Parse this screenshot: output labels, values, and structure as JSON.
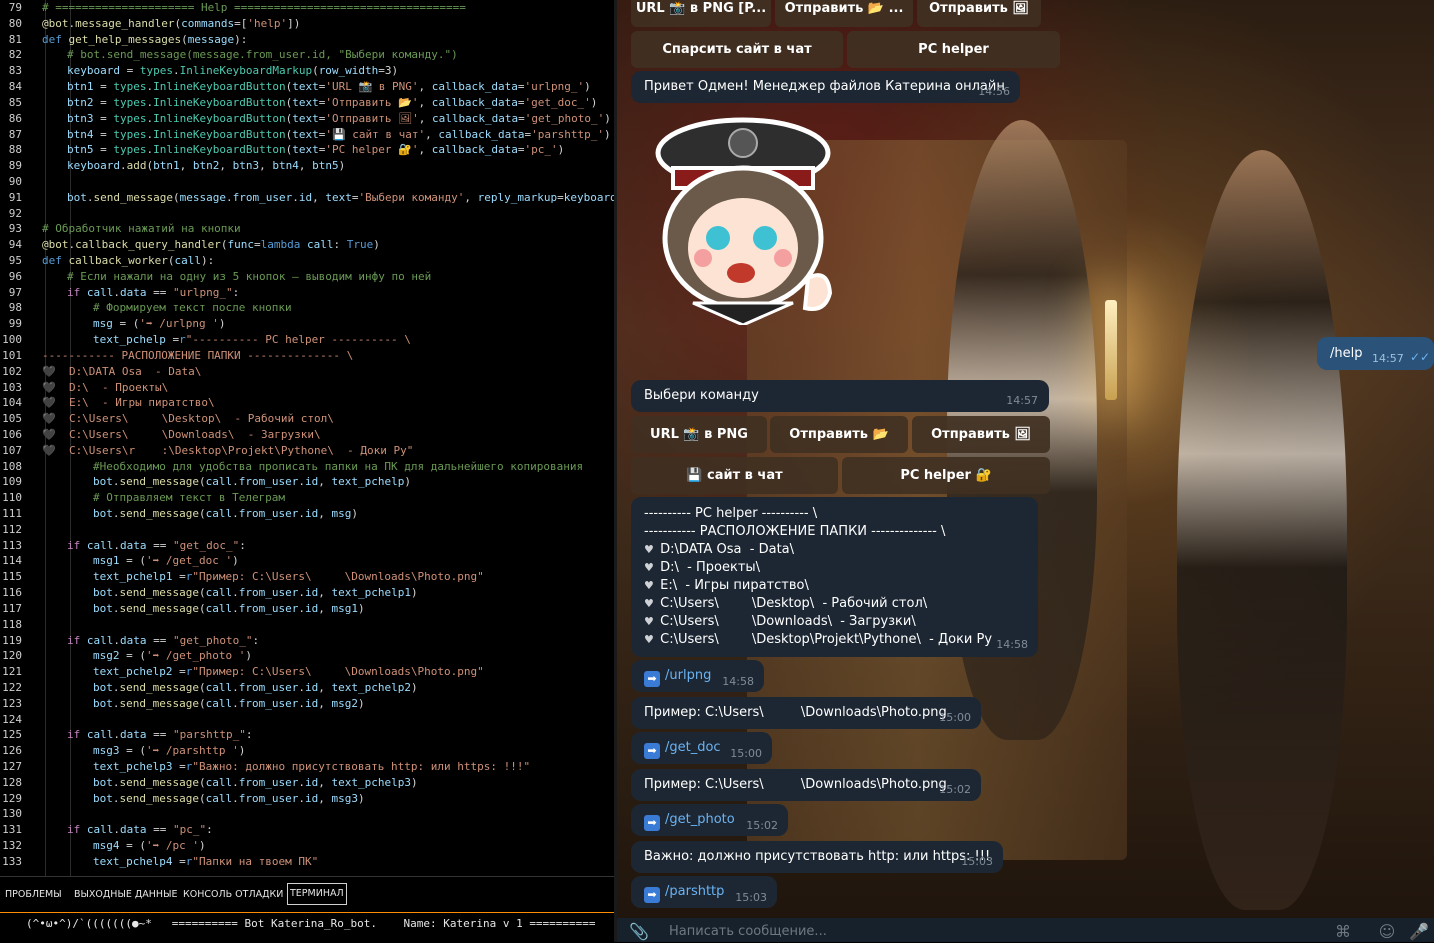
{
  "editor": {
    "lines": [
      {
        "n": "79",
        "indent": 0,
        "html": "<span class='c-comment'># ===================== Help ===================================</span>"
      },
      {
        "n": "80",
        "indent": 0,
        "html": "<span class='c-dec'>@bot</span>.<span class='c-fn'>message_handler</span>(<span class='c-var'>commands</span>=[<span class='c-str'>'help'</span>])"
      },
      {
        "n": "81",
        "indent": 0,
        "html": "<span class='c-kw'>def</span> <span class='c-fn'>get_help_messages</span>(<span class='c-var'>message</span>):"
      },
      {
        "n": "82",
        "indent": 1,
        "html": "<span class='c-comment'># bot.send_message(message.from_user.id, \"Выбери команду.\")</span>"
      },
      {
        "n": "83",
        "indent": 1,
        "html": "<span class='c-var'>keyboard</span> = <span class='c-cls'>types</span>.<span class='c-cls'>InlineKeyboardMarkup</span>(<span class='c-var'>row_width</span>=3)"
      },
      {
        "n": "84",
        "indent": 1,
        "html": "<span class='c-var'>btn1</span> = <span class='c-cls'>types</span>.<span class='c-cls'>InlineKeyboardButton</span>(<span class='c-var'>text</span>=<span class='c-str'>'URL 📸 в PNG'</span>, <span class='c-var'>callback_data</span>=<span class='c-str'>'urlpng_'</span>)"
      },
      {
        "n": "85",
        "indent": 1,
        "html": "<span class='c-var'>btn2</span> = <span class='c-cls'>types</span>.<span class='c-cls'>InlineKeyboardButton</span>(<span class='c-var'>text</span>=<span class='c-str'>'Отправить 📂'</span>, <span class='c-var'>callback_data</span>=<span class='c-str'>'get_doc_'</span>)"
      },
      {
        "n": "86",
        "indent": 1,
        "html": "<span class='c-var'>btn3</span> = <span class='c-cls'>types</span>.<span class='c-cls'>InlineKeyboardButton</span>(<span class='c-var'>text</span>=<span class='c-str'>'Отправить 🖼'</span>, <span class='c-var'>callback_data</span>=<span class='c-str'>'get_photo_'</span>)"
      },
      {
        "n": "87",
        "indent": 1,
        "html": "<span class='c-var'>btn4</span> = <span class='c-cls'>types</span>.<span class='c-cls'>InlineKeyboardButton</span>(<span class='c-var'>text</span>=<span class='c-str'>'💾 сайт в чат'</span>, <span class='c-var'>callback_data</span>=<span class='c-str'>'parshttp_'</span>)"
      },
      {
        "n": "88",
        "indent": 1,
        "html": "<span class='c-var'>btn5</span> = <span class='c-cls'>types</span>.<span class='c-cls'>InlineKeyboardButton</span>(<span class='c-var'>text</span>=<span class='c-str'>'PC helper 🔐'</span>, <span class='c-var'>callback_data</span>=<span class='c-str'>'pc_'</span>)"
      },
      {
        "n": "89",
        "indent": 1,
        "html": "<span class='c-var'>keyboard</span>.<span class='c-fn'>add</span>(<span class='c-var'>btn1</span>, <span class='c-var'>btn2</span>, <span class='c-var'>btn3</span>, <span class='c-var'>btn4</span>, <span class='c-var'>btn5</span>)"
      },
      {
        "n": "90",
        "indent": 1,
        "html": ""
      },
      {
        "n": "91",
        "indent": 1,
        "html": "<span class='c-var'>bot</span>.<span class='c-fn'>send_message</span>(<span class='c-var'>message</span>.<span class='c-var'>from_user</span>.<span class='c-var'>id</span>, <span class='c-var'>text</span>=<span class='c-str'>'Выбери команду'</span>, <span class='c-var'>reply_markup</span>=<span class='c-var'>keyboard</span>)"
      },
      {
        "n": "92",
        "indent": 0,
        "html": ""
      },
      {
        "n": "93",
        "indent": 0,
        "html": "<span class='c-comment'># Обработчик нажатий на кнопки</span>"
      },
      {
        "n": "94",
        "indent": 0,
        "html": "<span class='c-dec'>@bot</span>.<span class='c-fn'>callback_query_handler</span>(<span class='c-var'>func</span>=<span class='c-kw'>lambda</span> <span class='c-var'>call</span>: <span class='c-kw'>True</span>)"
      },
      {
        "n": "95",
        "indent": 0,
        "html": "<span class='c-kw'>def</span> <span class='c-fn'>callback_worker</span>(<span class='c-var'>call</span>):"
      },
      {
        "n": "96",
        "indent": 1,
        "html": "<span class='c-comment'># Если нажали на одну из 5 кнопок — выводим инфу по ней</span>"
      },
      {
        "n": "97",
        "indent": 1,
        "html": "<span class='c-ctl'>if</span> <span class='c-var'>call</span>.<span class='c-var'>data</span> == <span class='c-str'>\"urlpng_\"</span>:"
      },
      {
        "n": "98",
        "indent": 2,
        "html": "<span class='c-comment'># Формируем текст после кнопки</span>"
      },
      {
        "n": "99",
        "indent": 2,
        "html": "<span class='c-var'>msg</span> = (<span class='c-str'>'➡ /urlpng '</span>)"
      },
      {
        "n": "100",
        "indent": 2,
        "html": "<span class='c-var'>text_pchelp</span> =<span class='c-kw'>r</span><span class='c-str'>\"---------- PC helper ---------- \\</span>"
      },
      {
        "n": "101",
        "indent": 0,
        "html": "<span class='c-str'>----------- РАСПОЛОЖЕНИЕ ПАПКИ -------------- \\</span>"
      },
      {
        "n": "102",
        "indent": 0,
        "html": "<span class='c-str'>🖤  D:\\DATA Osa  - Data\\</span>"
      },
      {
        "n": "103",
        "indent": 0,
        "html": "<span class='c-str'>🖤  D:\\  - Проекты\\</span>"
      },
      {
        "n": "104",
        "indent": 0,
        "html": "<span class='c-str'>🖤  E:\\  - Игры пиратство\\</span>"
      },
      {
        "n": "105",
        "indent": 0,
        "html": "<span class='c-str'>🖤  C:\\Users\\     \\Desktop\\  - Рабочий стол\\</span>"
      },
      {
        "n": "106",
        "indent": 0,
        "html": "<span class='c-str'>🖤  C:\\Users\\     \\Downloads\\  - Загрузки\\</span>"
      },
      {
        "n": "107",
        "indent": 0,
        "html": "<span class='c-str'>🖤  C:\\Users\\r    :\\Desktop\\Projekt\\Pythone\\  - Доки Ру\"</span>"
      },
      {
        "n": "108",
        "indent": 2,
        "html": "<span class='c-comment'>#Необходимо для удобства прописать папки на ПК для дальнейшего копирования</span>"
      },
      {
        "n": "109",
        "indent": 2,
        "html": "<span class='c-var'>bot</span>.<span class='c-fn'>send_message</span>(<span class='c-var'>call</span>.<span class='c-var'>from_user</span>.<span class='c-var'>id</span>, <span class='c-var'>text_pchelp</span>)"
      },
      {
        "n": "110",
        "indent": 2,
        "html": "<span class='c-comment'># Отправляем текст в Телеграм</span>"
      },
      {
        "n": "111",
        "indent": 2,
        "html": "<span class='c-var'>bot</span>.<span class='c-fn'>send_message</span>(<span class='c-var'>call</span>.<span class='c-var'>from_user</span>.<span class='c-var'>id</span>, <span class='c-var'>msg</span>)"
      },
      {
        "n": "112",
        "indent": 1,
        "html": ""
      },
      {
        "n": "113",
        "indent": 1,
        "html": "<span class='c-ctl'>if</span> <span class='c-var'>call</span>.<span class='c-var'>data</span> == <span class='c-str'>\"get_doc_\"</span>:"
      },
      {
        "n": "114",
        "indent": 2,
        "html": "<span class='c-var'>msg1</span> = (<span class='c-str'>'➡ /get_doc '</span>)"
      },
      {
        "n": "115",
        "indent": 2,
        "html": "<span class='c-var'>text_pchelp1</span> =<span class='c-kw'>r</span><span class='c-str'>\"Пример: C:\\Users\\     \\Downloads\\Photo.png\"</span>"
      },
      {
        "n": "116",
        "indent": 2,
        "html": "<span class='c-var'>bot</span>.<span class='c-fn'>send_message</span>(<span class='c-var'>call</span>.<span class='c-var'>from_user</span>.<span class='c-var'>id</span>, <span class='c-var'>text_pchelp1</span>)"
      },
      {
        "n": "117",
        "indent": 2,
        "html": "<span class='c-var'>bot</span>.<span class='c-fn'>send_message</span>(<span class='c-var'>call</span>.<span class='c-var'>from_user</span>.<span class='c-var'>id</span>, <span class='c-var'>msg1</span>)"
      },
      {
        "n": "118",
        "indent": 1,
        "html": ""
      },
      {
        "n": "119",
        "indent": 1,
        "html": "<span class='c-ctl'>if</span> <span class='c-var'>call</span>.<span class='c-var'>data</span> == <span class='c-str'>\"get_photo_\"</span>:"
      },
      {
        "n": "120",
        "indent": 2,
        "html": "<span class='c-var'>msg2</span> = (<span class='c-str'>'➡ /get_photo '</span>)"
      },
      {
        "n": "121",
        "indent": 2,
        "html": "<span class='c-var'>text_pchelp2</span> =<span class='c-kw'>r</span><span class='c-str'>\"Пример: C:\\Users\\     \\Downloads\\Photo.png\"</span>"
      },
      {
        "n": "122",
        "indent": 2,
        "html": "<span class='c-var'>bot</span>.<span class='c-fn'>send_message</span>(<span class='c-var'>call</span>.<span class='c-var'>from_user</span>.<span class='c-var'>id</span>, <span class='c-var'>text_pchelp2</span>)"
      },
      {
        "n": "123",
        "indent": 2,
        "html": "<span class='c-var'>bot</span>.<span class='c-fn'>send_message</span>(<span class='c-var'>call</span>.<span class='c-var'>from_user</span>.<span class='c-var'>id</span>, <span class='c-var'>msg2</span>)"
      },
      {
        "n": "124",
        "indent": 1,
        "html": ""
      },
      {
        "n": "125",
        "indent": 1,
        "html": "<span class='c-ctl'>if</span> <span class='c-var'>call</span>.<span class='c-var'>data</span> == <span class='c-str'>\"parshttp_\"</span>:"
      },
      {
        "n": "126",
        "indent": 2,
        "html": "<span class='c-var'>msg3</span> = (<span class='c-str'>'➡ /parshttp '</span>)"
      },
      {
        "n": "127",
        "indent": 2,
        "html": "<span class='c-var'>text_pchelp3</span> =<span class='c-kw'>r</span><span class='c-str'>\"Важно: должно присутствовать http: или https: !!!\"</span>"
      },
      {
        "n": "128",
        "indent": 2,
        "html": "<span class='c-var'>bot</span>.<span class='c-fn'>send_message</span>(<span class='c-var'>call</span>.<span class='c-var'>from_user</span>.<span class='c-var'>id</span>, <span class='c-var'>text_pchelp3</span>)"
      },
      {
        "n": "129",
        "indent": 2,
        "html": "<span class='c-var'>bot</span>.<span class='c-fn'>send_message</span>(<span class='c-var'>call</span>.<span class='c-var'>from_user</span>.<span class='c-var'>id</span>, <span class='c-var'>msg3</span>)"
      },
      {
        "n": "130",
        "indent": 1,
        "html": ""
      },
      {
        "n": "131",
        "indent": 1,
        "html": "<span class='c-ctl'>if</span> <span class='c-var'>call</span>.<span class='c-var'>data</span> == <span class='c-str'>\"pc_\"</span>:"
      },
      {
        "n": "132",
        "indent": 2,
        "html": "<span class='c-var'>msg4</span> = (<span class='c-str'>'➡ /pc '</span>)"
      },
      {
        "n": "133",
        "indent": 2,
        "html": "<span class='c-var'>text_pchelp4</span> =<span class='c-kw'>r</span><span class='c-str'>\"Папки на твоем ПК\"</span>"
      }
    ]
  },
  "panel": {
    "tabs": [
      "ПРОБЛЕМЫ",
      "ВЫХОДНЫЕ ДАННЫЕ",
      "КОНСОЛЬ ОТЛАДКИ",
      "ТЕРМИНАЛ"
    ],
    "active_tab": "ТЕРМИНАЛ",
    "terminal_line": "(^•ω•^)/`(((((((●~*   ========== Bot Katerina_Ro_bot.    Name: Katerina v 1 =========="
  },
  "chat": {
    "top_buttons_row1": [
      "URL 📸 в PNG [P...",
      "Отправить 📂 ...",
      "Отправить 🖼"
    ],
    "top_buttons_row2": [
      "Спарсить сайт в чат",
      "PC helper"
    ],
    "greeting": {
      "text": "Привет Одмен! Менеджер файлов Катерина онлайн",
      "time": "14:56"
    },
    "outgoing": {
      "text": "/help",
      "time": "14:57"
    },
    "menu_message": {
      "text": "Выбери команду",
      "time": "14:57"
    },
    "menu_row1": [
      "URL 📸 в PNG",
      "Отправить 📂",
      "Отправить 🖼"
    ],
    "menu_row2": [
      "💾 сайт в чат",
      "PC helper 🔐"
    ],
    "pc_helper": {
      "lines": [
        "---------- PC helper ---------- \\",
        "----------- РАСПОЛОЖЕНИЕ ПАПКИ -------------- \\"
      ],
      "paths": [
        "D:\\DATA Osa  - Data\\",
        "D:\\  - Проекты\\",
        "E:\\  - Игры пиратство\\",
        "C:\\Users\\        \\Desktop\\  - Рабочий стол\\",
        "C:\\Users\\        \\Downloads\\  - Загрузки\\",
        "C:\\Users\\        \\Desktop\\Projekt\\Pythone\\  - Доки Ру"
      ],
      "time": "14:58"
    },
    "messages": [
      {
        "cmd": "/urlpng",
        "time": "14:58"
      },
      {
        "text": "Пример: C:\\Users\\         \\Downloads\\Photo.png",
        "time": "15:00"
      },
      {
        "cmd": "/get_doc",
        "time": "15:00"
      },
      {
        "text": "Пример: C:\\Users\\         \\Downloads\\Photo.png",
        "time": "15:02"
      },
      {
        "cmd": "/get_photo",
        "time": "15:02"
      },
      {
        "text": "Важно: должно присутствовать http: или https: !!!",
        "time": "15:03"
      },
      {
        "cmd": "/parshttp",
        "time": "15:03"
      }
    ],
    "input_placeholder": "Написать сообщение..."
  }
}
